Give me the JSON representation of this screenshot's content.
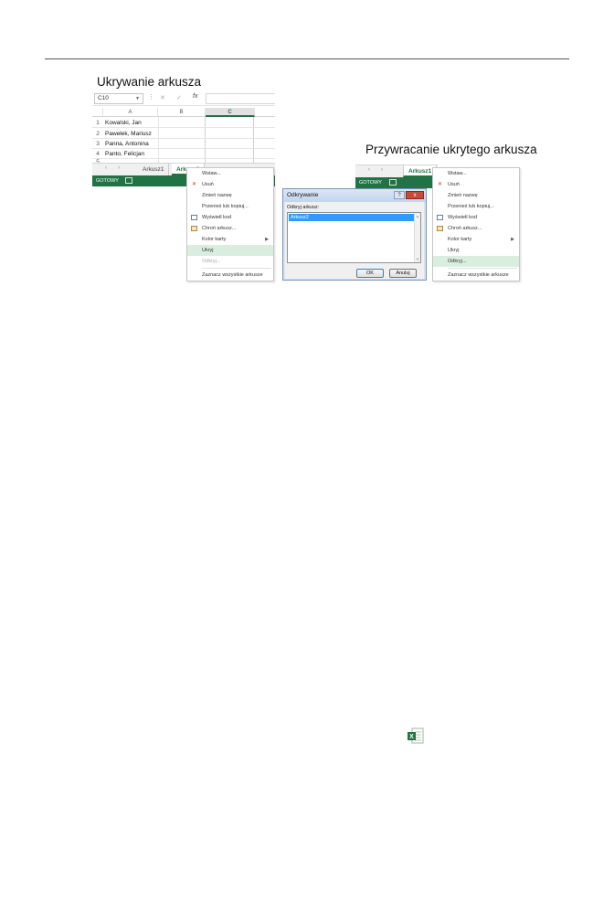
{
  "headings": {
    "hiding": "Ukrywanie arkusza",
    "restoring": "Przywracanie ukrytego arkusza"
  },
  "excel_left": {
    "name_box": "C10",
    "fx_label": "fx",
    "columns": [
      "A",
      "B",
      "C"
    ],
    "rows": [
      {
        "num": "1",
        "a": "Kowalski, Jan"
      },
      {
        "num": "2",
        "a": "Pawełek, Mariusz"
      },
      {
        "num": "3",
        "a": "Panna, Antonina"
      },
      {
        "num": "4",
        "a": "Panto, Felicjan"
      },
      {
        "num": "5",
        "a": ""
      }
    ],
    "tabs": [
      "Arkusz1",
      "Arkusz2"
    ],
    "status": "GOTOWY"
  },
  "menu_left": {
    "items": [
      "Wstaw...",
      "Usuń",
      "Zmień nazwę",
      "Przenieś lub kopiuj...",
      "Wyświetl kod",
      "Chroń arkusz...",
      "Kolor karty",
      "Ukryj",
      "Odkryj...",
      "Zaznacz wszystkie arkusze"
    ]
  },
  "excel_right": {
    "tabs": [
      "Arkusz1"
    ],
    "status": "GOTOWY"
  },
  "dialog": {
    "title": "Odkrywanie",
    "help": "?",
    "close": "x",
    "label": "Odkryj arkusz:",
    "list_items": [
      "Arkusz2"
    ],
    "ok": "OK",
    "cancel": "Anuluj"
  },
  "menu_right": {
    "items": [
      "Wstaw...",
      "Usuń",
      "Zmień nazwę",
      "Przenieś lub kopiuj...",
      "Wyświetl kod",
      "Chroń arkusz...",
      "Kolor karty",
      "Ukryj",
      "Odkryj...",
      "Zaznacz wszystkie arkusze"
    ]
  },
  "colors": {
    "excel_green": "#217346",
    "menu_highlight": "#d9eedf",
    "selection_blue": "#3399ff"
  }
}
